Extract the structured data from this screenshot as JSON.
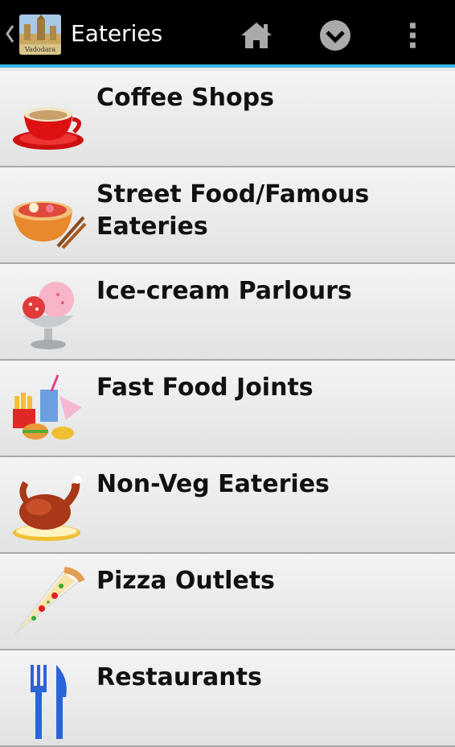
{
  "action_bar": {
    "title": "Eateries",
    "app_icon_caption": "Vadodara",
    "icons": [
      "home-icon",
      "check-circle-icon",
      "overflow-menu-icon"
    ],
    "accent_color": "#33b5e5"
  },
  "list": {
    "items": [
      {
        "label": "Coffee Shops",
        "icon": "coffee-cup-icon"
      },
      {
        "label": "Street Food/Famous Eateries",
        "icon": "noodle-bowl-icon"
      },
      {
        "label": "Ice-cream Parlours",
        "icon": "ice-cream-icon"
      },
      {
        "label": "Fast Food Joints",
        "icon": "fast-food-icon"
      },
      {
        "label": "Non-Veg Eateries",
        "icon": "roast-chicken-icon"
      },
      {
        "label": "Pizza Outlets",
        "icon": "pizza-slice-icon"
      },
      {
        "label": "Restaurants",
        "icon": "fork-knife-icon"
      }
    ]
  }
}
